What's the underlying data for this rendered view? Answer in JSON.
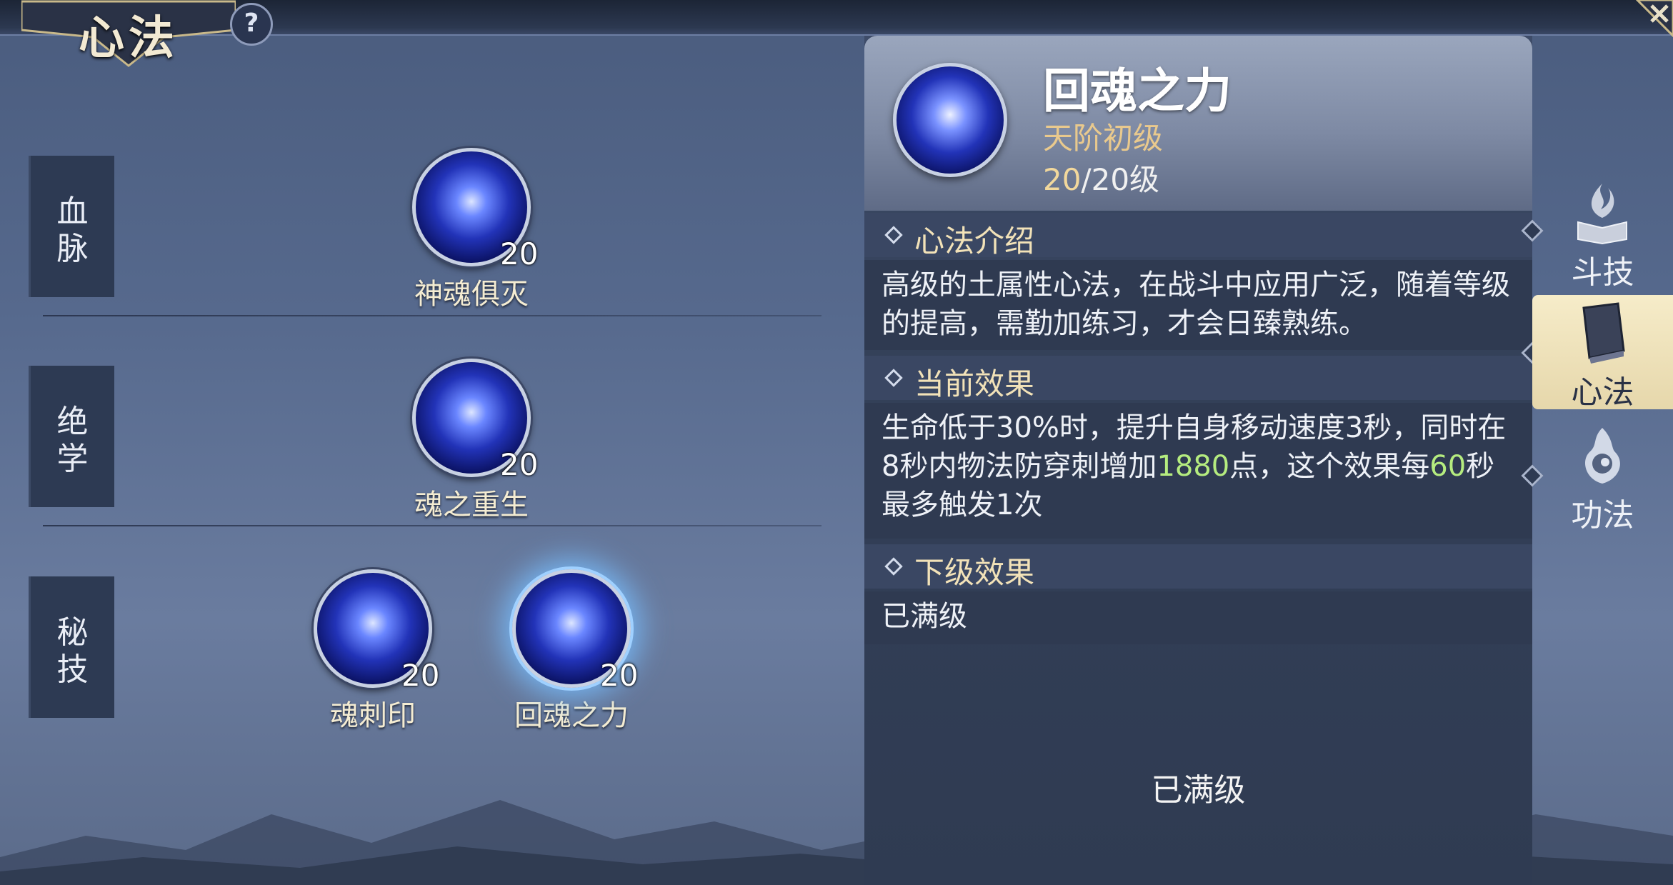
{
  "header": {
    "title": "心法",
    "help_label": "?"
  },
  "rows": [
    {
      "label_line1": "血",
      "label_line2": "脉"
    },
    {
      "label_line1": "绝",
      "label_line2": "学"
    },
    {
      "label_line1": "秘",
      "label_line2": "技"
    }
  ],
  "skills": [
    {
      "name": "神魂俱灭",
      "level": "20",
      "row": 0
    },
    {
      "name": "魂之重生",
      "level": "20",
      "row": 1
    },
    {
      "name": "魂刺印",
      "level": "20",
      "row": 2
    },
    {
      "name": "回魂之力",
      "level": "20",
      "row": 2,
      "selected": true
    }
  ],
  "detail": {
    "title": "回魂之力",
    "grade": "天阶初级",
    "level_current": "20",
    "level_rest": "/20级",
    "sections": [
      {
        "heading": "心法介绍",
        "text": "高级的土属性心法，在战斗中应用广泛，随着等级的提高，需勤加练习，才会日臻熟练。"
      },
      {
        "heading": "当前效果",
        "text_part1": "生命低于30%时，提升自身移动速度3秒，同时在8秒内物法防穿刺增加",
        "highlight1": "1880",
        "text_part2": "点，这个效果每",
        "highlight2": "60",
        "text_part3": "秒最多触发1次"
      },
      {
        "heading": "下级效果",
        "text": "已满级"
      }
    ],
    "bottom_status": "已满级"
  },
  "side_tabs": [
    {
      "label": "斗技",
      "icon": "flaming-book-icon",
      "active": false
    },
    {
      "label": "心法",
      "icon": "book-icon",
      "active": true
    },
    {
      "label": "功法",
      "icon": "flame-swirl-icon",
      "active": false
    }
  ],
  "colors": {
    "highlight_green": "#b5ec7f",
    "grade_gold": "#e9c98d",
    "active_tab": "#f6ecc9"
  }
}
